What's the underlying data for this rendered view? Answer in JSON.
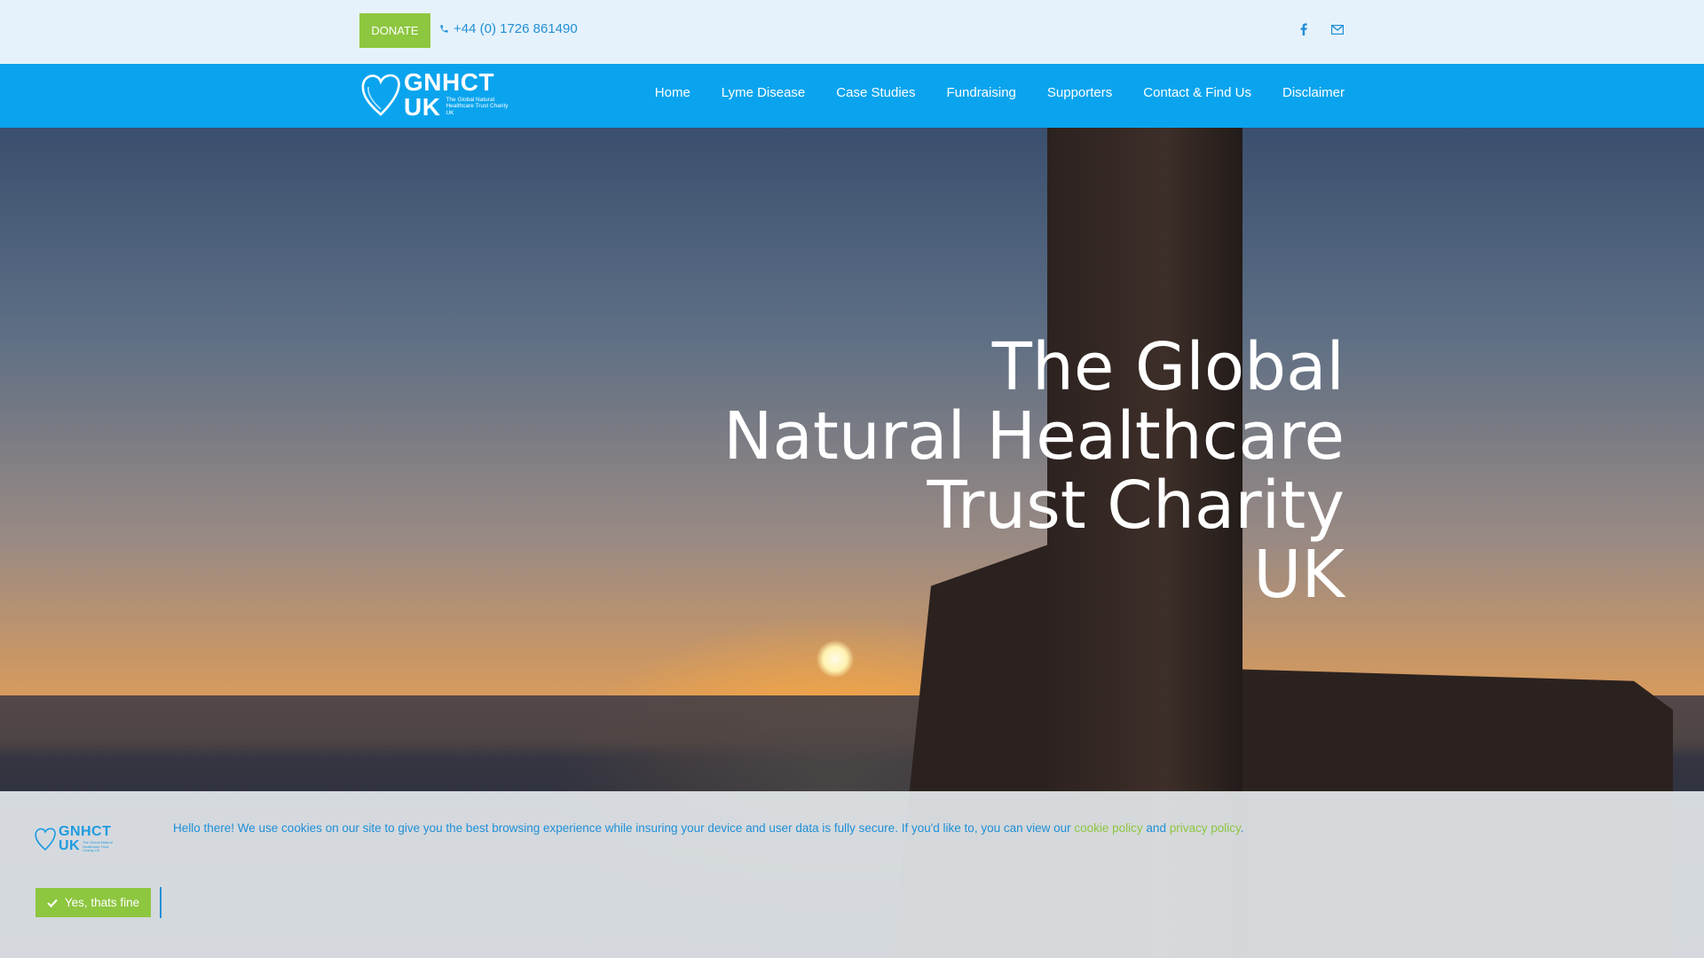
{
  "topbar": {
    "donate_label": "DONATE",
    "phone": "+44 (0) 1726 861490"
  },
  "logo": {
    "line1": "GNHCT",
    "line2": "UK",
    "sub": "The Global Natural Healthcare Trust Charity UK"
  },
  "nav": {
    "items": [
      {
        "label": "Home"
      },
      {
        "label": "Lyme Disease"
      },
      {
        "label": "Case Studies"
      },
      {
        "label": "Fundraising"
      },
      {
        "label": "Supporters"
      },
      {
        "label": "Contact & Find Us"
      },
      {
        "label": "Disclaimer"
      }
    ]
  },
  "hero": {
    "title_line1": "The Global",
    "title_line2": "Natural Healthcare",
    "title_line3": "Trust Charity",
    "title_line4": "UK"
  },
  "cookie": {
    "text_before": "Hello there! We use cookies on our site to give you the best browsing experience while insuring your device and user data is fully secure. If you'd like to, you can view our ",
    "cookie_policy": "cookie policy",
    "and": " and ",
    "privacy_policy": "privacy policy",
    "period": ".",
    "accept_label": "Yes, thats fine"
  },
  "colors": {
    "accent_green": "#8dc63f",
    "nav_blue": "#0aa4ee",
    "link_blue": "#1f8fd6",
    "topbar_bg": "#e6f2fb"
  },
  "icons": [
    "phone-icon",
    "facebook-icon",
    "email-icon",
    "heart-logo-icon",
    "check-icon"
  ]
}
